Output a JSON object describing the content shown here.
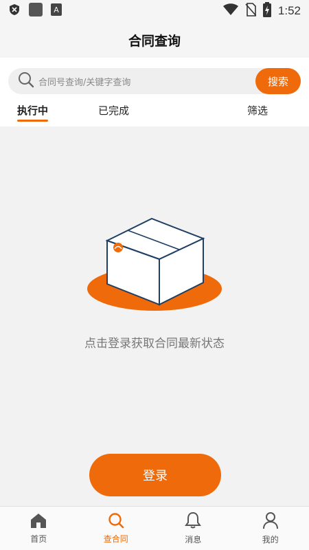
{
  "status_bar": {
    "time": "1:52"
  },
  "header": {
    "title": "合同查询"
  },
  "search": {
    "placeholder": "合同号查询/关键字查询",
    "button_label": "搜索"
  },
  "tabs": [
    {
      "label": "执行中",
      "active": true
    },
    {
      "label": "已完成",
      "active": false
    }
  ],
  "filter_label": "筛选",
  "empty_state": {
    "message": "点击登录获取合同最新状态"
  },
  "login_button_label": "登录",
  "bottom_nav": [
    {
      "label": "首页",
      "icon": "home-icon",
      "active": false
    },
    {
      "label": "查合同",
      "icon": "search-icon",
      "active": true
    },
    {
      "label": "消息",
      "icon": "bell-icon",
      "active": false
    },
    {
      "label": "我的",
      "icon": "person-icon",
      "active": false
    }
  ],
  "colors": {
    "accent": "#ef6a0a",
    "box_outline": "#1f3e63"
  }
}
